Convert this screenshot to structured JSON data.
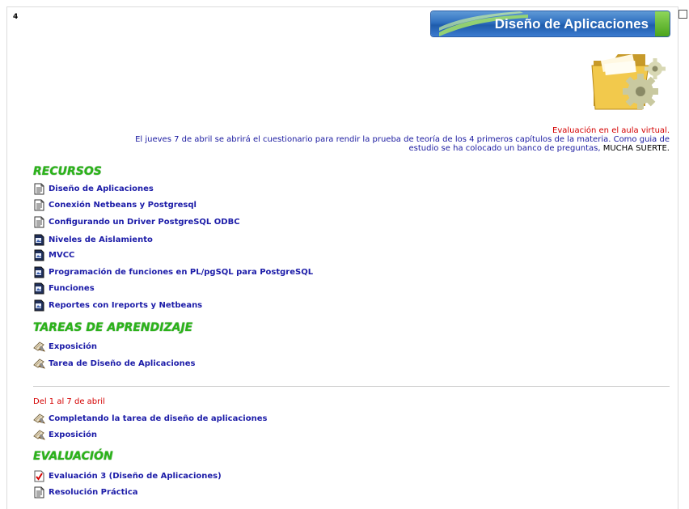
{
  "week": {
    "number": "4"
  },
  "banner": {
    "title": "Diseño de Aplicaciones"
  },
  "notice": {
    "line1": "Evaluación en el aula virtual.",
    "line2": "El jueves 7 de abril se abrirá el cuestionario para rendir la prueba de teoría de los 4 primeros capítulos de la materia. Como guia de",
    "line3a": "estudio se ha colocado un banco de preguntas,",
    "line3b": " MUCHA SUERTE."
  },
  "recursos": {
    "heading": "RECURSOS",
    "items": [
      {
        "label": "Diseño de Aplicaciones",
        "icon": "document-icon"
      },
      {
        "label": "Conexión Netbeans y Postgresql",
        "icon": "document-icon"
      },
      {
        "label": "Configurando un Driver PostgreSQL ODBC",
        "icon": "document-icon"
      },
      {
        "label": "Niveles de Aislamiento",
        "icon": "pdf-icon"
      },
      {
        "label": "MVCC",
        "icon": "pdf-icon"
      },
      {
        "label": "Programación de funciones en PL/pgSQL para PostgreSQL",
        "icon": "pdf-icon"
      },
      {
        "label": "Funciones",
        "icon": "pdf-icon"
      },
      {
        "label": "Reportes con Ireports y Netbeans",
        "icon": "pdf-icon"
      }
    ]
  },
  "tareas": {
    "heading": "TAREAS DE APRENDIZAJE",
    "items": [
      {
        "label": "Exposición",
        "icon": "assignment-icon"
      },
      {
        "label": "Tarea de Diseño de Aplicaciones",
        "icon": "assignment-icon"
      }
    ]
  },
  "semana": {
    "date_range": "Del 1 al 7 de abril",
    "items": [
      {
        "label": "Completando la tarea de diseño de aplicaciones",
        "icon": "assignment-icon"
      },
      {
        "label": "Exposición",
        "icon": "assignment-icon"
      }
    ]
  },
  "evaluacion": {
    "heading": "EVALUACIÓN",
    "items": [
      {
        "label": "Evaluación 3 (Diseño de Aplicaciones)",
        "icon": "quiz-icon"
      },
      {
        "label": "Resolución Práctica",
        "icon": "document-icon"
      }
    ]
  },
  "colors": {
    "section_heading": "#2bb31a",
    "link": "#1c1ca8",
    "alert": "#d40000"
  }
}
